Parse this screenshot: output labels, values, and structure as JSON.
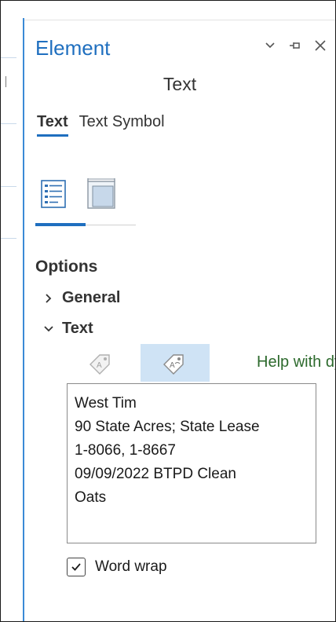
{
  "panel": {
    "title": "Element",
    "subtitle": "Text",
    "controls": [
      {
        "icon": "chevron-down-icon"
      },
      {
        "icon": "pin-icon"
      },
      {
        "icon": "close-icon"
      }
    ]
  },
  "tabs": [
    {
      "label": "Text",
      "active": true
    },
    {
      "label": "Text Symbol",
      "active": false
    }
  ],
  "view_icons": [
    {
      "icon": "properties-list-icon",
      "active": true
    },
    {
      "icon": "frame-display-icon",
      "active": false
    }
  ],
  "options": {
    "title": "Options",
    "groups": [
      {
        "label": "General",
        "expanded": false
      },
      {
        "label": "Text",
        "expanded": true
      }
    ]
  },
  "text_toolbar": {
    "buttons": [
      {
        "icon": "tag-a-icon",
        "active": false
      },
      {
        "icon": "dynamic-tag-icon",
        "active": true
      }
    ],
    "help_link": "Help with dyn"
  },
  "text_box": {
    "value": "West Tim\n90 State Acres; State Lease\n1-8066, 1-8667\n09/09/2022 BTPD Clean\nOats"
  },
  "word_wrap": {
    "label": "Word wrap",
    "checked": true
  },
  "colors": {
    "accent": "#1f6fbf",
    "link_green": "#2d6a2d",
    "active_button_bg": "#cfe3f5"
  }
}
